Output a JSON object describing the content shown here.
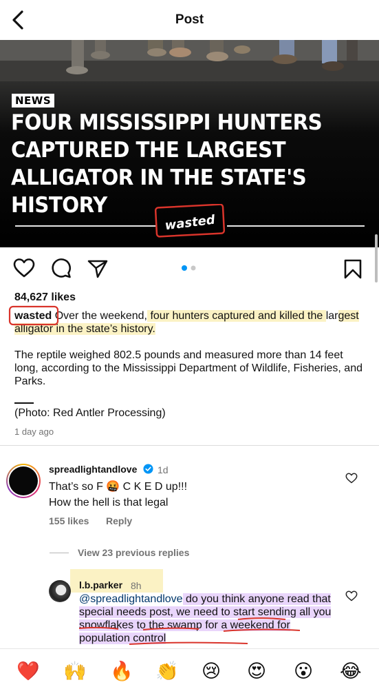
{
  "header": {
    "title": "Post"
  },
  "media": {
    "badge": "NEWS",
    "headline": "FOUR MISSISSIPPI HUNTERS CAPTURED THE LARGEST ALLIGATOR IN THE STATE'S HISTORY",
    "logo_text": "wasted"
  },
  "actions": {
    "carousel_count": 2,
    "carousel_active": 1
  },
  "post": {
    "likes": "84,627 likes",
    "username": "wasted",
    "caption_part1": "Over the weekend,",
    "caption_part2": " four hunters captured and killed the ",
    "caption_part3": "lar",
    "caption_part4": "gest alligator in the state’s history.",
    "paragraph2": "The reptile weighed 802.5 pounds and measured more than 14 feet long, according to the Mississippi Department of Wildlife, Fisheries, and Parks.",
    "photo_credit": "(Photo: Red Antler Processing)",
    "time": "1 day ago"
  },
  "comments": [
    {
      "username": "spreadlightandlove",
      "time": "1d",
      "line1": "That’s so F 🤬 C K E D  up!!!",
      "line2": "How the hell is that legal",
      "likes": "155 likes",
      "reply": "Reply"
    }
  ],
  "view_replies": "View 23 previous replies",
  "reply": {
    "username": "l.b.parker",
    "time": "8h",
    "mention": "@spreadlightandlove",
    "text": " do you think anyone read that special needs post, we need to start sending all you snowflakes to the swamp for a weekend for population control"
  },
  "emoji_bar": [
    "❤️",
    "🙌",
    "🔥",
    "👏",
    "😢",
    "😍",
    "😮",
    "😂"
  ],
  "colors": {
    "highlight_yellow": "#fbf2c4",
    "highlight_purple": "#e9d5fb",
    "annotation_red": "#d9342b",
    "accent_blue": "#0095f6"
  }
}
